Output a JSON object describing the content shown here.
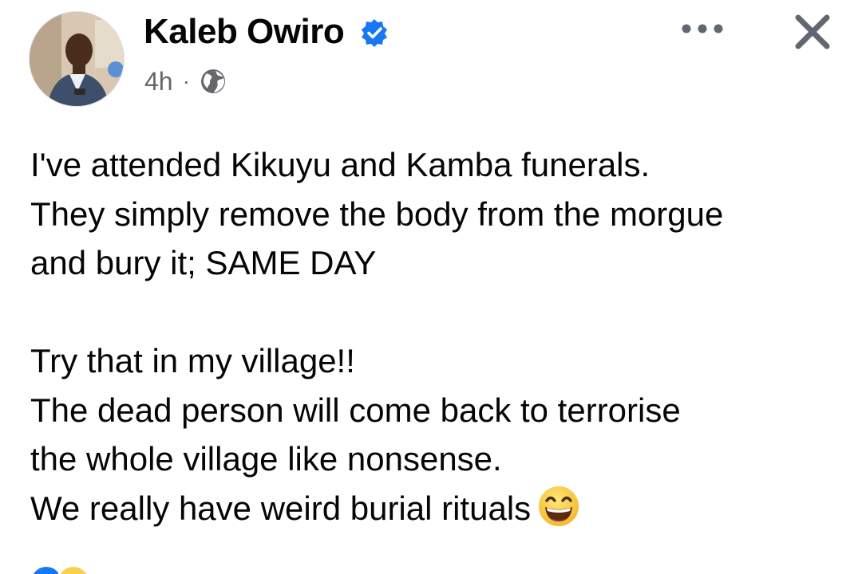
{
  "post": {
    "author": "Kaleb Owiro",
    "verified": true,
    "time": "4h",
    "separator": "·",
    "audience_icon": "globe-icon",
    "more_icon": "more-options-icon",
    "close_icon": "close-icon",
    "lines": [
      "I've attended Kikuyu and Kamba funerals.",
      "They simply remove the body from the morgue",
      "and bury it; SAME DAY",
      "",
      "Try that in my village!!",
      "The dead person will come back to terrorise",
      "the whole village like nonsense.",
      "We really have weird burial rituals"
    ],
    "emoji": "grinning-squinting-face-emoji",
    "reactions": [
      "like-reaction-icon",
      "haha-reaction-icon"
    ]
  },
  "colors": {
    "text_primary": "#050505",
    "text_secondary": "#65676b",
    "verified_blue": "#1877f2",
    "like_blue": "#1877f2",
    "haha_yellow": "#f7d14c"
  }
}
